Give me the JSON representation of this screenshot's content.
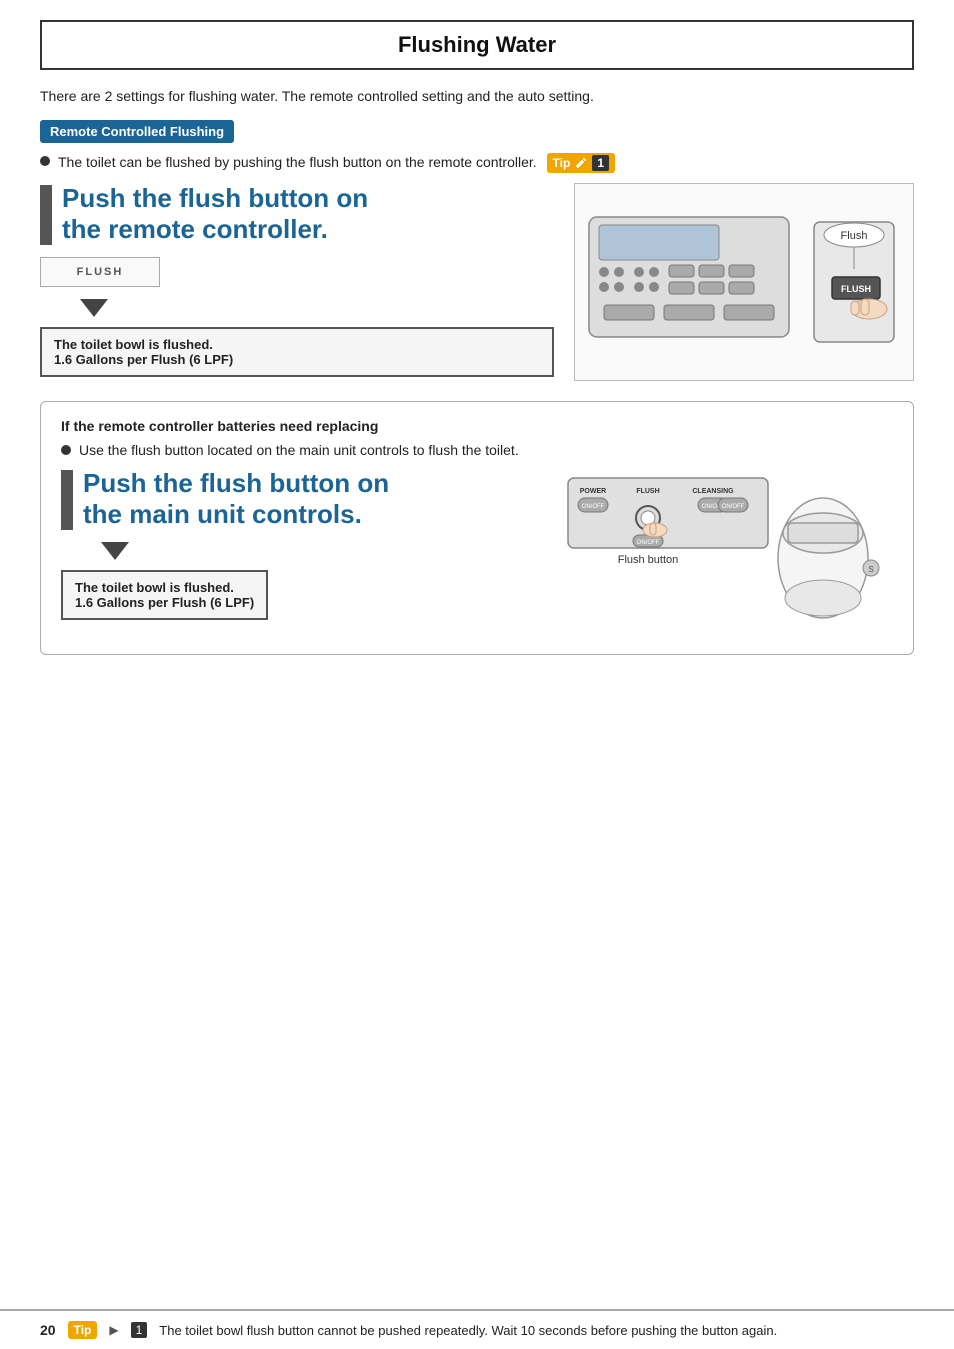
{
  "page": {
    "title": "Flushing Water",
    "intro": "There are 2 settings for flushing water. The remote controlled setting and the auto setting.",
    "page_number": "20"
  },
  "section1": {
    "label": "Remote Controlled Flushing",
    "bullet": "The toilet can be flushed by pushing the flush button on the remote controller.",
    "tip_label": "Tip",
    "tip_number": "1",
    "step_heading_line1": "Push the flush button on",
    "step_heading_line2": "the remote controller.",
    "flush_label": "FLUSH",
    "result_line1": "The toilet bowl is flushed.",
    "result_line2": "1.6 Gallons per Flush (6 LPF)",
    "flush_remote_label": "Flush",
    "flush_button_label": "FLUSH"
  },
  "section2": {
    "title": "If the remote controller batteries need replacing",
    "bullet": "Use the flush button located on the main unit controls to flush the toilet.",
    "step_heading_line1": "Push the flush button on",
    "step_heading_line2": "the main unit controls.",
    "result_line1": "The toilet bowl is flushed.",
    "result_line2": "1.6 Gallons per Flush (6 LPF)",
    "flush_button_caption": "Flush button",
    "power_label": "POWER",
    "flush_label": "FLUSH",
    "cleansing_label": "CLEANSING",
    "on_off_label": "ON/OFF"
  },
  "footer": {
    "tip_label": "Tip",
    "arrow": "▶",
    "tip_number": "1",
    "text": "The toilet bowl flush button cannot be pushed repeatedly. Wait 10 seconds before pushing the button again."
  },
  "colors": {
    "blue": "#1a6496",
    "orange": "#f0a500",
    "dark": "#333",
    "light_border": "#bbb"
  }
}
